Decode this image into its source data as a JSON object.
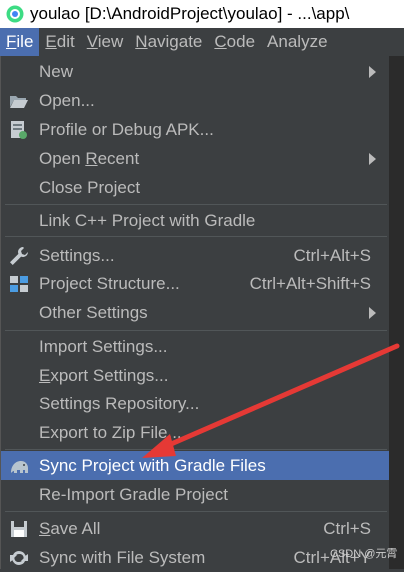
{
  "window": {
    "title": "youlao [D:\\AndroidProject\\youlao] - ...\\app\\"
  },
  "menubar": {
    "items": [
      {
        "mn": "F",
        "rest": "ile"
      },
      {
        "mn": "E",
        "rest": "dit"
      },
      {
        "mn": "V",
        "rest": "iew"
      },
      {
        "mn": "N",
        "rest": "avigate"
      },
      {
        "mn": "C",
        "rest": "ode"
      },
      {
        "label": "Analyze"
      }
    ]
  },
  "file_menu": {
    "new": "New",
    "open": "Open...",
    "profile_debug": "Profile or Debug APK...",
    "open_recent_a": "Open ",
    "open_recent_b": "R",
    "open_recent_c": "ecent",
    "close_project": "Close Project",
    "link_cpp": "Link C++ Project with Gradle",
    "settings": "Settings...",
    "settings_shortcut": "Ctrl+Alt+S",
    "project_structure": "Project Structure...",
    "project_structure_shortcut": "Ctrl+Alt+Shift+S",
    "other_settings": "Other Settings",
    "import_settings": "Import Settings...",
    "export_settings_m": "E",
    "export_settings_rest": "xport Settings...",
    "settings_repository": "Settings Repository...",
    "export_zip": "Export to Zip File...",
    "sync_gradle": "Sync Project with Gradle Files",
    "reimport_gradle": "Re-Import Gradle Project",
    "save_all_m": "S",
    "save_all_rest": "ave All",
    "save_all_shortcut": "Ctrl+S",
    "sync_fs": "Sync with File System",
    "sync_fs_shortcut": "Ctrl+Alt+Y"
  },
  "watermark": "CSDN @元霄",
  "colors": {
    "menu_bg": "#3c3f41",
    "highlight": "#4b6eaf",
    "text": "#bbbbbb",
    "annotation_arrow": "#e53935"
  }
}
